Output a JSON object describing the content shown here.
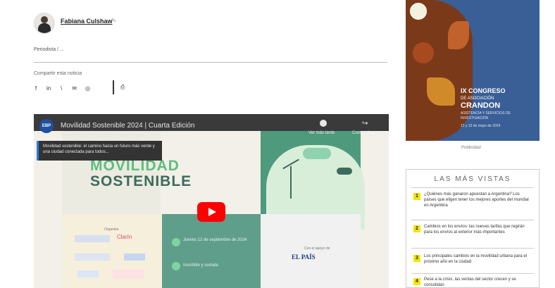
{
  "article": {
    "author": "Fabiana Culshaw",
    "intro": "Periodista / ...",
    "share_label": "Compartir esta noticia",
    "share_icons": [
      "facebook-icon",
      "linkedin-icon",
      "twitter-icon",
      "email-icon",
      "whatsapp-icon"
    ],
    "share_glyphs": [
      "f",
      "in",
      "\\",
      "✉",
      "◎"
    ],
    "print_glyph": "⎙"
  },
  "video": {
    "channel_logo": "EBP",
    "title": "Movilidad Sostenible 2024 | Cuarta Edición",
    "watch_later": "Ver más tarde",
    "share": "Compartir",
    "overlay_text": "Movilidad sostenible: el camino hacia un futuro más verde y una ciudad conectada para todos...",
    "headline_1": "MOVILIDAD",
    "headline_2": "SOSTENIBLE",
    "sponsors_label": "Organiza",
    "sponsor_2": "Clarín",
    "mid_text_1": "Jueves 12 de septiembre de 2024",
    "mid_text_2": "Inscribite y sumate",
    "media_partner_label": "Con el apoyo de",
    "media_partner": "EL PAÍS"
  },
  "sidebar": {
    "ad": {
      "line1": "IX CONGRESO",
      "line2": "DE ASOCIACIÓN",
      "line3": "CRANDON",
      "line4": "ASISTENCIA Y SERVICIOS DE INVESTIGACIÓN",
      "line5": "12 y 13 de mayo de 2024"
    },
    "ad_caption": "Publicidad",
    "most_viewed": {
      "title": "LAS MÁS VISTAS",
      "items": [
        {
          "num": "1",
          "text": "¿Quiénes más ganaron apuestan a Argentina? Los países que eligen tener los mejores aportes del mundial en Argentina"
        },
        {
          "num": "2",
          "text": "Cambios en los envíos: las nuevas tarifas que regirán para los envíos al exterior más importantes"
        },
        {
          "num": "3",
          "text": "Los principales cambios en la movilidad urbana para el próximo año en la ciudad"
        },
        {
          "num": "4",
          "text": "Pese a la crisis, las ventas del sector crecen y se consolidan"
        }
      ]
    }
  }
}
